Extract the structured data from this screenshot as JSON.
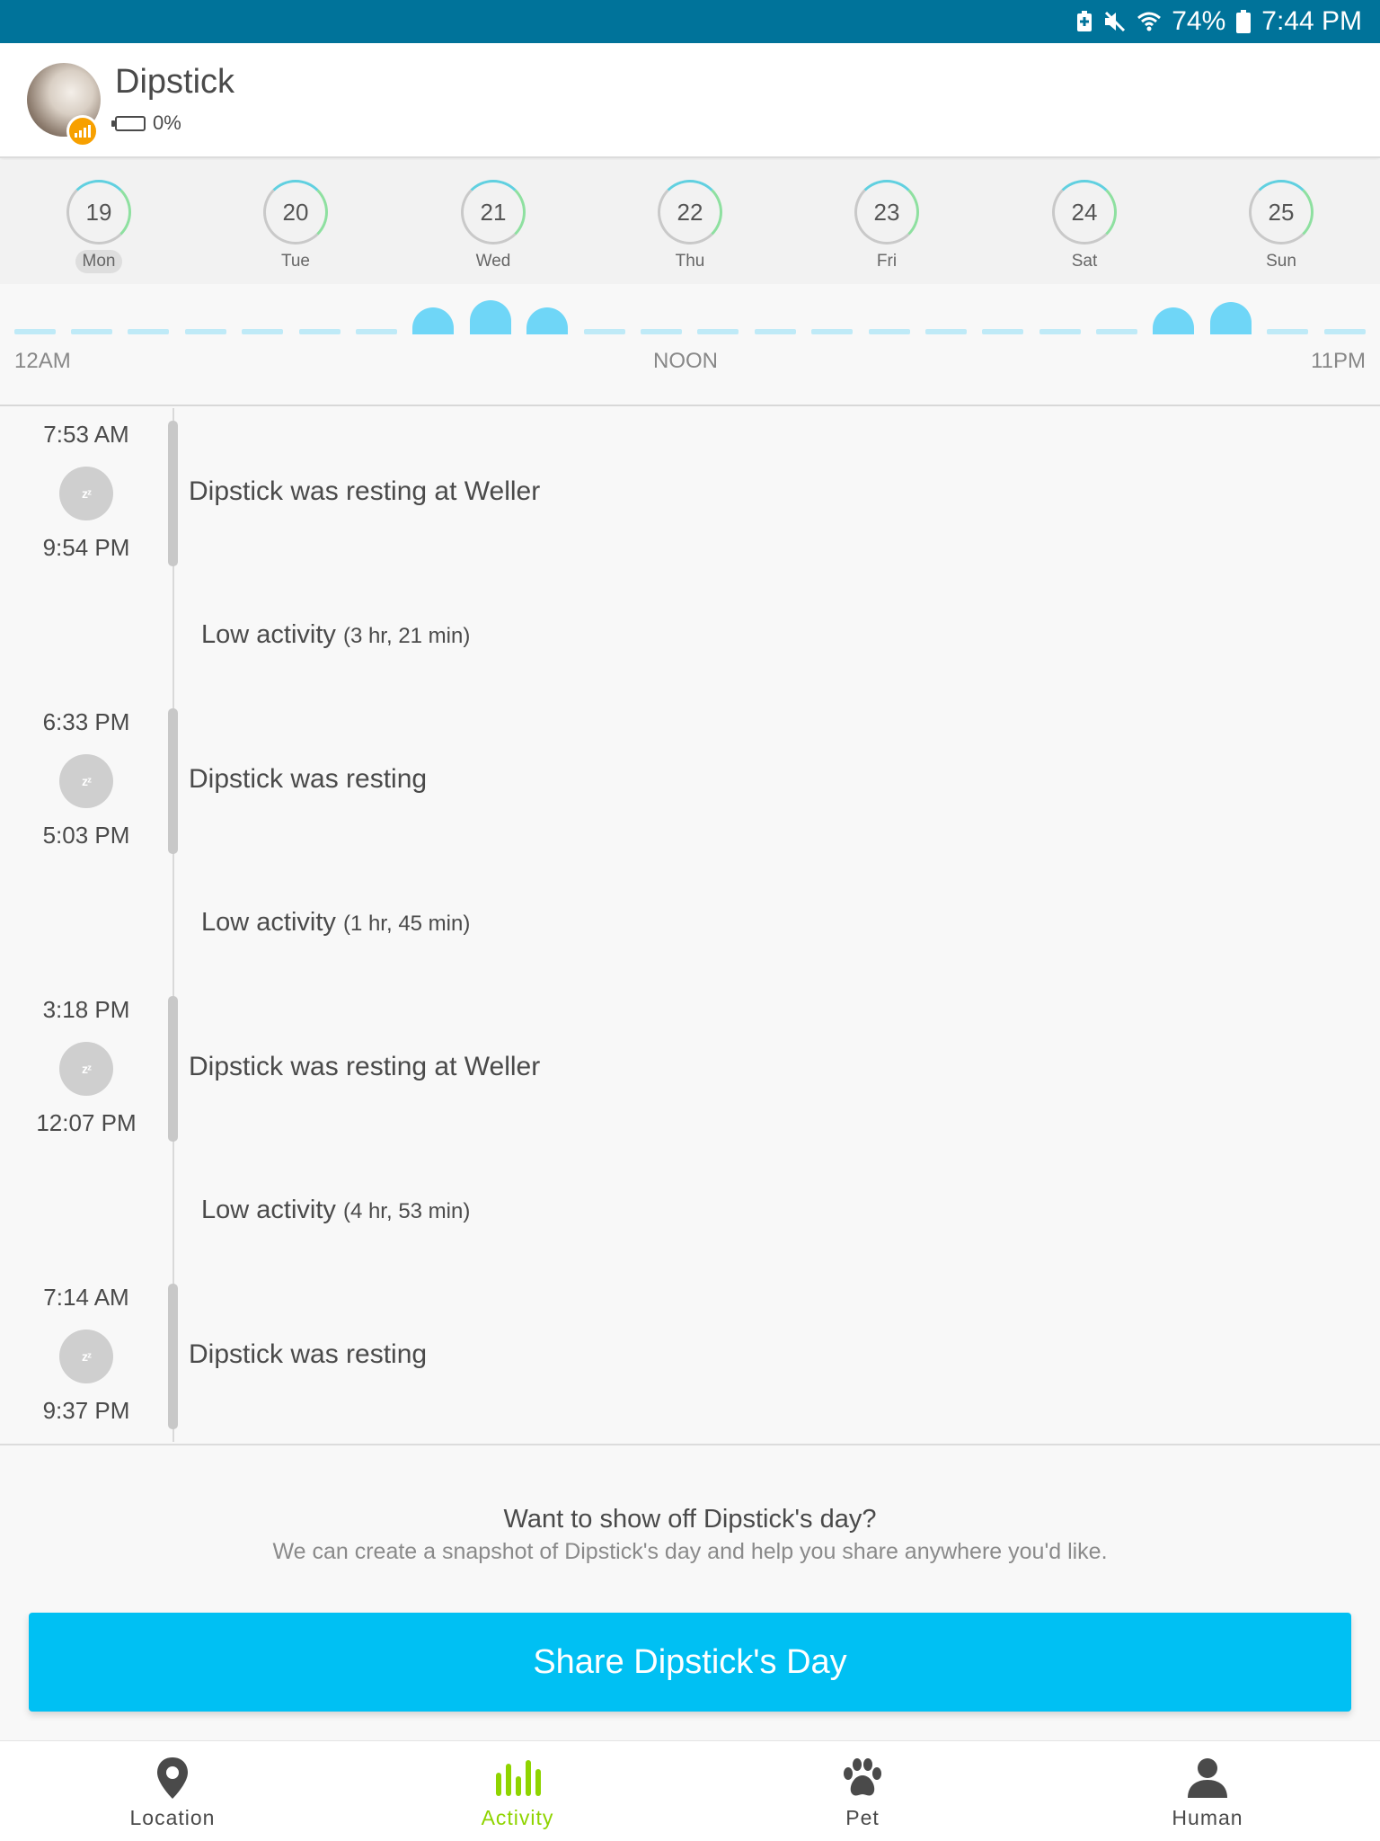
{
  "status_bar": {
    "battery_percent": "74%",
    "time": "7:44 PM",
    "icons": [
      "battery-saver-icon",
      "mute-icon",
      "wifi-icon",
      "battery-icon"
    ]
  },
  "header": {
    "pet_name": "Dipstick",
    "battery": "0%",
    "avatar_badge_icon": "signal-icon"
  },
  "days": [
    {
      "number": "19",
      "label": "Mon",
      "selected": true
    },
    {
      "number": "20",
      "label": "Tue",
      "selected": false
    },
    {
      "number": "21",
      "label": "Wed",
      "selected": false
    },
    {
      "number": "22",
      "label": "Thu",
      "selected": false
    },
    {
      "number": "23",
      "label": "Fri",
      "selected": false
    },
    {
      "number": "24",
      "label": "Sat",
      "selected": false
    },
    {
      "number": "25",
      "label": "Sun",
      "selected": false
    }
  ],
  "activity_strip": {
    "start_label": "12AM",
    "mid_label": "NOON",
    "end_label": "11PM"
  },
  "timeline": {
    "events": [
      {
        "start": "7:53 AM",
        "end": "9:54 PM",
        "text": "Dipstick was resting at Weller",
        "icon": "sleep-icon"
      },
      {
        "start": "6:33 PM",
        "end": "5:03 PM",
        "text": "Dipstick was resting",
        "icon": "sleep-icon"
      },
      {
        "start": "3:18 PM",
        "end": "12:07 PM",
        "text": "Dipstick was resting at Weller",
        "icon": "sleep-icon"
      },
      {
        "start": "7:14 AM",
        "end": "9:37 PM",
        "text": "Dipstick was resting",
        "icon": "sleep-icon"
      }
    ],
    "gaps": [
      {
        "label": "Low activity",
        "duration": "(3 hr, 21 min)"
      },
      {
        "label": "Low activity",
        "duration": "(1 hr, 45 min)"
      },
      {
        "label": "Low activity",
        "duration": "(4 hr, 53 min)"
      }
    ]
  },
  "share": {
    "title": "Want to show off Dipstick's day?",
    "subtitle": "We can create a snapshot of Dipstick's day and help you share anywhere you'd like.",
    "button": "Share Dipstick's Day"
  },
  "nav": {
    "items": [
      {
        "label": "Location",
        "icon": "location-pin-icon",
        "active": false
      },
      {
        "label": "Activity",
        "icon": "activity-bars-icon",
        "active": true
      },
      {
        "label": "Pet",
        "icon": "paw-icon",
        "active": false
      },
      {
        "label": "Human",
        "icon": "person-icon",
        "active": false
      }
    ]
  },
  "colors": {
    "status_bar": "#00739a",
    "accent": "#00c0f3",
    "active_nav": "#8fd400",
    "activity_bump": "#6fd6f7",
    "badge": "#f7a000"
  }
}
